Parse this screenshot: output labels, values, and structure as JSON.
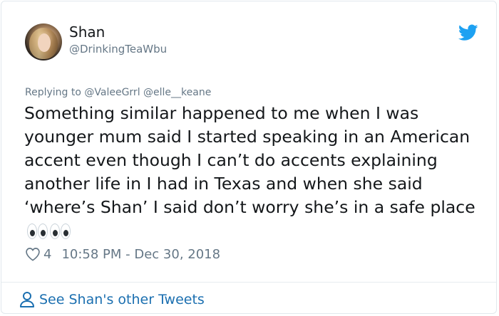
{
  "author": {
    "name": "Shan",
    "handle": "@DrinkingTeaWbu"
  },
  "reply": {
    "prefix": "Replying to",
    "mentions": "@ValeeGrrl @elle__keane"
  },
  "tweet": {
    "text": "Something similar happened to me when I was younger mum said I started speaking in an American accent even though I can’t do accents explaining another life in I had in Texas and when she said ‘where’s Shan’ I said don’t worry she’s in a safe place",
    "emoji": [
      "eyes-emoji",
      "eyes-emoji"
    ]
  },
  "meta": {
    "likes": "4",
    "timestamp": "10:58 PM - Dec 30, 2018"
  },
  "footer": {
    "see_more": "See Shan's other Tweets"
  },
  "colors": {
    "twitter_blue": "#1da1f2",
    "link": "#1b6fb0",
    "secondary_text": "#657786",
    "primary_text": "#14171a"
  },
  "icons": {
    "brand": "twitter-bird-icon",
    "like": "heart-icon",
    "profile": "person-icon"
  }
}
